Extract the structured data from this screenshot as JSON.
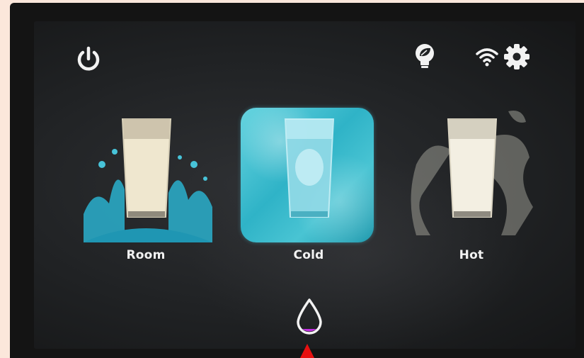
{
  "device": {
    "top_bar": {
      "power_icon": "power-icon",
      "eco_icon": "eco-leaf-bulb-icon",
      "wifi_icon": "wifi-icon",
      "settings_icon": "gear-icon"
    },
    "options": [
      {
        "label": "Room",
        "selected": false
      },
      {
        "label": "Cold",
        "selected": true
      },
      {
        "label": "Hot",
        "selected": false
      }
    ],
    "dispense_icon": "water-drop-icon",
    "colors": {
      "icon": "#f2f2f2",
      "cold_accent": "#3cbccf",
      "drop_fill": "#c030e0",
      "pointer": "#e81010"
    }
  }
}
